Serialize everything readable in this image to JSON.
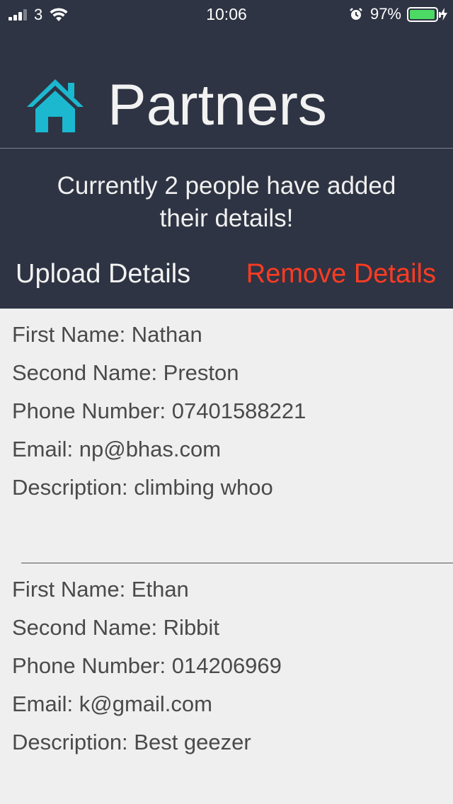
{
  "status_bar": {
    "carrier": "3",
    "time": "10:06",
    "battery_percent": "97%",
    "battery_level": 0.97,
    "icons": [
      "signal-icon",
      "wifi-icon",
      "alarm-icon",
      "battery-icon",
      "charging-bolt-icon"
    ]
  },
  "header": {
    "title": "Partners",
    "icon": "home-icon",
    "icon_color": "#1bb8d0",
    "background": "#2e3443",
    "summary_line1": "Currently 2 people have added",
    "summary_line2": "their details!"
  },
  "actions": {
    "upload_label": "Upload Details",
    "remove_label": "Remove Details",
    "remove_color": "#ff3b22"
  },
  "partners": [
    {
      "first_name": "First Name: Nathan",
      "second_name": "Second Name: Preston",
      "phone": "Phone Number: 07401588221",
      "email": "Email: np@bhas.com",
      "description": "Description: climbing whoo"
    },
    {
      "first_name": "First Name: Ethan",
      "second_name": "Second Name: Ribbit",
      "phone": "Phone Number: 014206969",
      "email": "Email: k@gmail.com",
      "description": "Description: Best geezer"
    }
  ]
}
